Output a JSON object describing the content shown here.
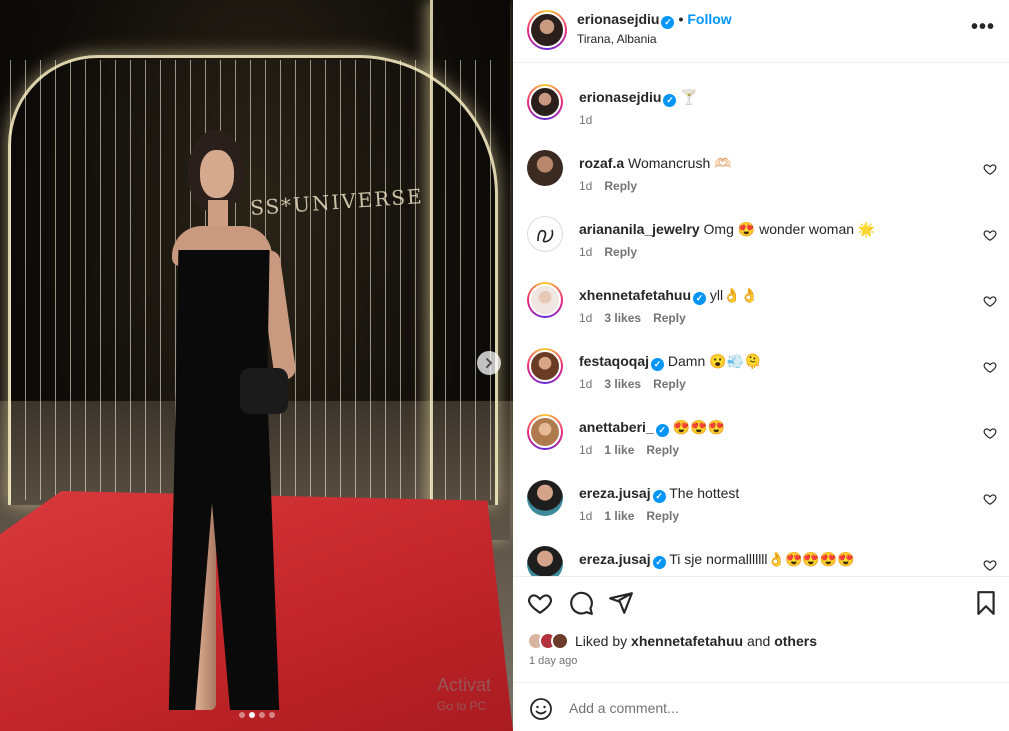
{
  "post": {
    "image_dots": [
      false,
      true,
      false,
      false
    ],
    "next_icon": "chevron-right-icon",
    "sign_text": "SS*UNIVERSE"
  },
  "header": {
    "username": "erionasejdiu",
    "separator": "•",
    "follow_label": "Follow",
    "location": "Tirana, Albania",
    "more_icon": "ellipsis-icon",
    "more_label": "•••"
  },
  "caption": {
    "username": "erionasejdiu",
    "text": "🍸",
    "time": "1d"
  },
  "comments": [
    {
      "username": "rozaf.a",
      "verified": false,
      "text": "Womancrush 🫶🏻",
      "time": "1d",
      "likes": "",
      "reply": "Reply"
    },
    {
      "username": "ariananila_jewelry",
      "verified": false,
      "text": "Omg 😍 wonder woman 🌟",
      "time": "1d",
      "likes": "",
      "reply": "Reply"
    },
    {
      "username": "xhennetafetahuu",
      "verified": true,
      "text": "yll👌👌",
      "time": "1d",
      "likes": "3 likes",
      "reply": "Reply"
    },
    {
      "username": "festaqoqaj",
      "verified": true,
      "text": "Damn 😮💨🫠",
      "time": "1d",
      "likes": "3 likes",
      "reply": "Reply"
    },
    {
      "username": "anettaberi_",
      "verified": true,
      "text": "😍😍😍",
      "time": "1d",
      "likes": "1 like",
      "reply": "Reply"
    },
    {
      "username": "ereza.jusaj",
      "verified": true,
      "text": "The hottest",
      "time": "1d",
      "likes": "1 like",
      "reply": "Reply"
    },
    {
      "username": "ereza.jusaj",
      "verified": true,
      "text": "Ti sje normalllllll👌😍😍😍😍",
      "time": "",
      "likes": "",
      "reply": ""
    }
  ],
  "actions": {
    "like_icon": "heart-icon",
    "comment_icon": "comment-icon",
    "share_icon": "paper-plane-icon",
    "save_icon": "bookmark-icon"
  },
  "likes": {
    "prefix": "Liked by",
    "user": "xhennetafetahuu",
    "and": "and",
    "others": "others"
  },
  "posted_ago": "1 day ago",
  "add_comment": {
    "placeholder": "Add a comment...",
    "emoji_icon": "smiley-icon"
  },
  "watermark": {
    "line1": "Activat",
    "line2": "Go to PC"
  },
  "colors": {
    "accent": "#0095f6",
    "text": "#262626",
    "secondary": "#737373"
  }
}
